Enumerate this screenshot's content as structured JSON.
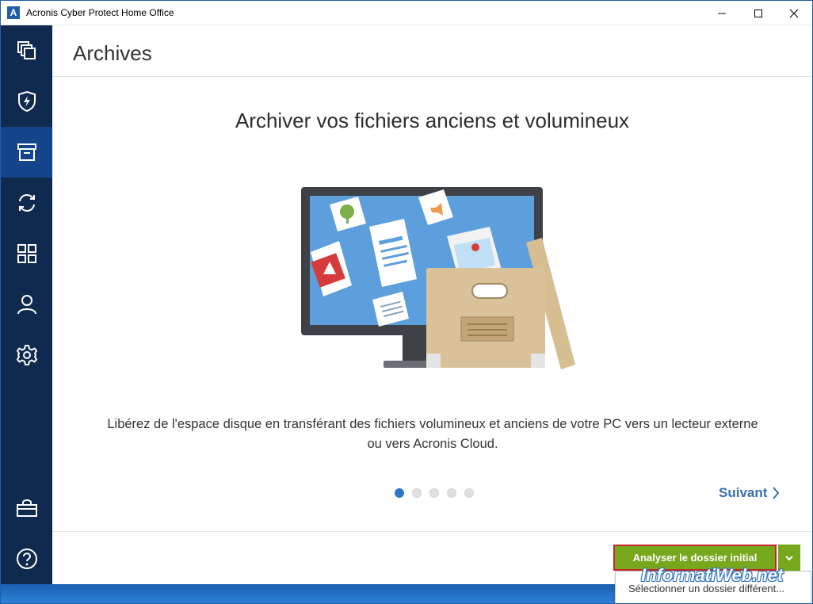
{
  "window": {
    "app_icon_letter": "A",
    "title": "Acronis Cyber Protect Home Office"
  },
  "sidebar": {
    "items": [
      {
        "icon": "backup-icon",
        "active": false
      },
      {
        "icon": "protection-shield-icon",
        "active": false
      },
      {
        "icon": "archive-icon",
        "active": true
      },
      {
        "icon": "sync-icon",
        "active": false
      },
      {
        "icon": "tools-grid-icon",
        "active": false
      },
      {
        "icon": "account-icon",
        "active": false
      },
      {
        "icon": "settings-gear-icon",
        "active": false
      },
      {
        "icon": "store-bag-icon",
        "active": false
      },
      {
        "icon": "help-icon",
        "active": false
      }
    ]
  },
  "main": {
    "page_title": "Archives",
    "headline": "Archiver vos fichiers anciens et volumineux",
    "description_line1": "Libérez de l'espace disque en transférant des fichiers volumineux et anciens de votre PC vers un lecteur externe",
    "description_line2": "ou vers Acronis Cloud.",
    "carousel": {
      "total": 5,
      "current": 1
    },
    "next_label": "Suivant"
  },
  "actions": {
    "analyze_label": "Analyser le dossier initial",
    "dropdown_item": "Sélectionner un dossier différent..."
  },
  "watermark": "InformatiWeb.net",
  "colors": {
    "sidebar_bg": "#0f2a4e",
    "sidebar_active": "#14448a",
    "primary_green": "#76a71d",
    "highlight_red": "#c8262a",
    "link_blue": "#3a6fb0",
    "dot_active": "#2c76c9"
  }
}
